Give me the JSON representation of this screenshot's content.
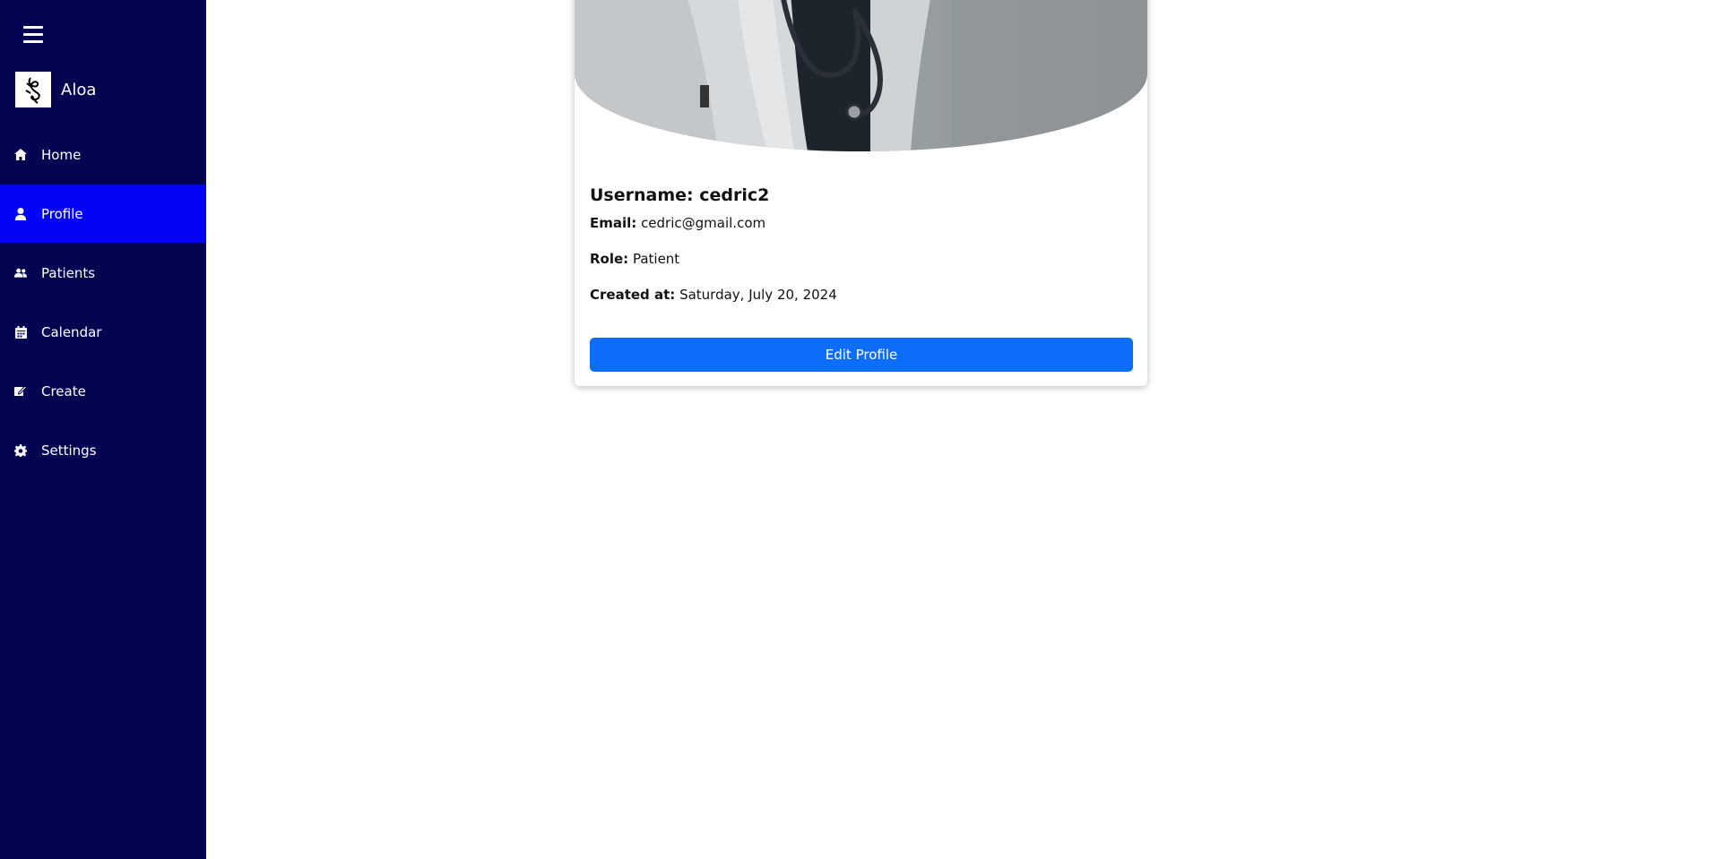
{
  "sidebar": {
    "brand_name": "Aloa",
    "items": [
      {
        "label": "Home",
        "icon": "home-icon"
      },
      {
        "label": "Profile",
        "icon": "user-icon",
        "active": true
      },
      {
        "label": "Patients",
        "icon": "users-icon"
      },
      {
        "label": "Calendar",
        "icon": "calendar-icon"
      },
      {
        "label": "Create",
        "icon": "edit-icon"
      },
      {
        "label": "Settings",
        "icon": "gear-icon"
      }
    ]
  },
  "profile": {
    "username_label": "Username:",
    "username": "cedric2",
    "email_label": "Email:",
    "email": "cedric@gmail.com",
    "role_label": "Role:",
    "role": "Patient",
    "created_label": "Created at:",
    "created": "Saturday, July 20, 2024",
    "edit_button": "Edit Profile"
  },
  "colors": {
    "sidebar_bg": "#020452",
    "active_item_bg": "#0303f7",
    "button_bg": "#0d6efd"
  }
}
